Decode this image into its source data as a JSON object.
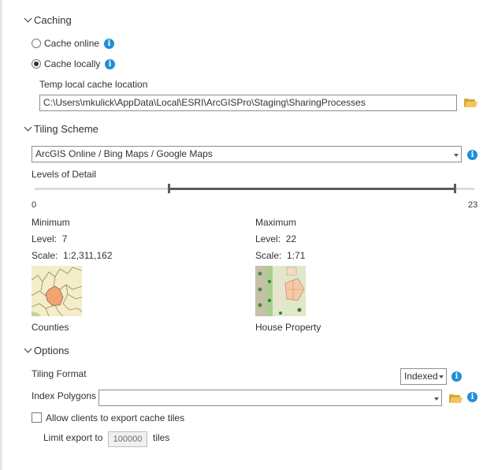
{
  "caching": {
    "header": "Caching",
    "options": [
      {
        "label": "Cache online",
        "checked": false
      },
      {
        "label": "Cache locally",
        "checked": true
      }
    ],
    "temp_location_label": "Temp local cache location",
    "temp_location_value": "C:\\Users\\mkulick\\AppData\\Local\\ESRI\\ArcGISPro\\Staging\\SharingProcesses"
  },
  "tiling_scheme": {
    "header": "Tiling Scheme",
    "selected": "ArcGIS Online / Bing Maps / Google Maps",
    "levels_label": "Levels of Detail",
    "slider": {
      "min": 0,
      "max": 23,
      "low": 7,
      "high": 22,
      "min_label": "0",
      "max_label": "23"
    },
    "minimum": {
      "title": "Minimum",
      "level_label": "Level:",
      "level_value": "7",
      "scale_label": "Scale:",
      "scale_value": "1:2,311,162",
      "thumb_caption": "Counties"
    },
    "maximum": {
      "title": "Maximum",
      "level_label": "Level:",
      "level_value": "22",
      "scale_label": "Scale:",
      "scale_value": "1:71",
      "thumb_caption": "House Property"
    }
  },
  "options": {
    "header": "Options",
    "tiling_format_label": "Tiling Format",
    "tiling_format_value": "Indexed",
    "index_polygons_label": "Index Polygons",
    "index_polygons_value": "",
    "allow_export_label": "Allow clients to export cache tiles",
    "allow_export_checked": false,
    "limit_export_label": "Limit export to",
    "limit_export_value": "100000",
    "limit_export_unit": "tiles"
  },
  "colors": {
    "info_blue": "#1f8fd8",
    "folder_yellow": "#f3c659",
    "text": "#323232"
  }
}
